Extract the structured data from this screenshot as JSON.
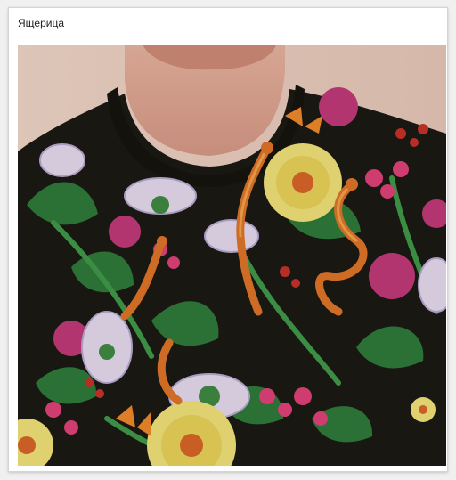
{
  "card": {
    "caption": "Ящерица"
  },
  "photo": {
    "alt": "Ящерица"
  }
}
